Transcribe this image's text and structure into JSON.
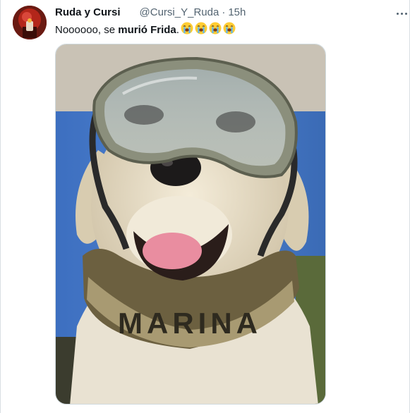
{
  "tweet": {
    "display_name": "Ruda y Cursi",
    "handle": "@Cursi_Y_Ruda",
    "separator": "·",
    "timestamp": "15h",
    "text_plain": "Noooooo, se ",
    "text_bold": "murió Frida",
    "text_end": ".",
    "emojis": [
      "loudly-crying-face",
      "loudly-crying-face",
      "loudly-crying-face",
      "loudly-crying-face"
    ],
    "more_icon": "more-horizontal-icon"
  },
  "media": {
    "collar_text": "MARINA"
  },
  "colors": {
    "name": "#0f1419",
    "secondary": "#536471",
    "border": "#cfd9de"
  }
}
